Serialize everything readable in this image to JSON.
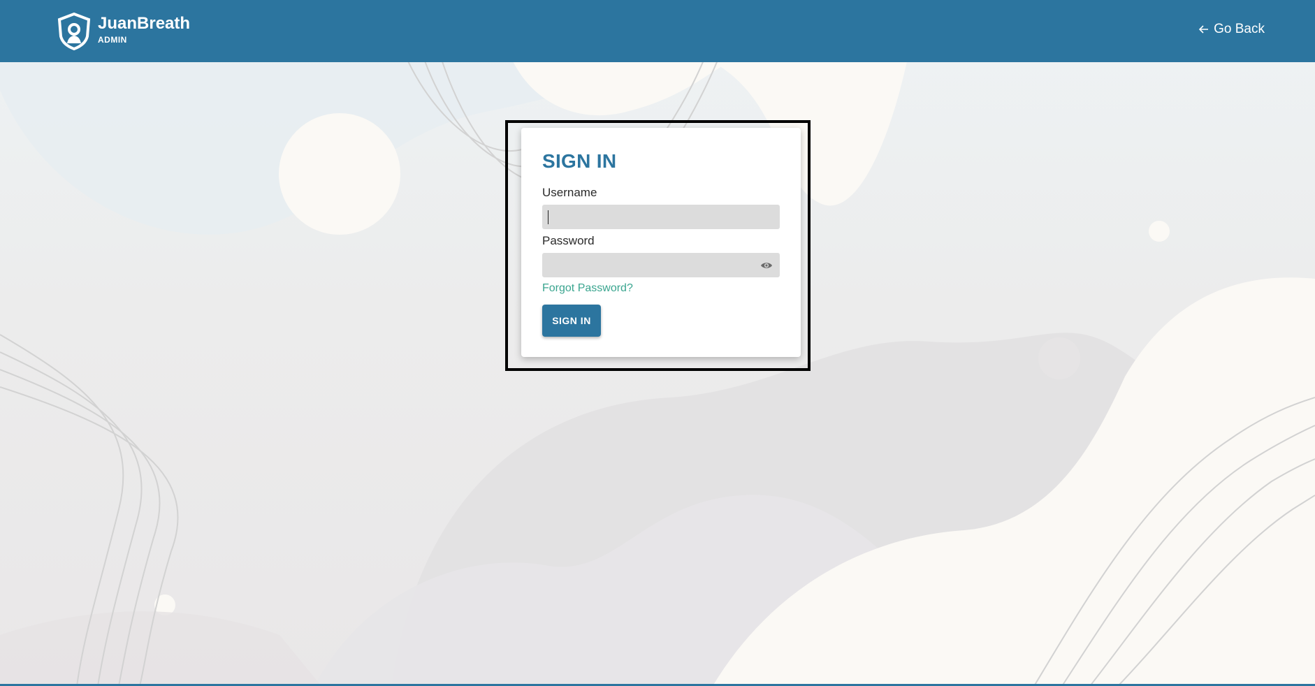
{
  "header": {
    "brand_name": "JuanBreath",
    "brand_sub": "ADMIN",
    "logo_icon": "shield-person-icon",
    "go_back_label": "Go Back",
    "go_back_icon": "arrow-left-icon",
    "background_color": "#2c759f"
  },
  "login": {
    "title": "SIGN IN",
    "username_label": "Username",
    "username_value": "",
    "password_label": "Password",
    "password_value": "",
    "password_toggle_icon": "eye-icon",
    "forgot_label": "Forgot Password?",
    "submit_label": "SIGN IN"
  },
  "colors": {
    "primary": "#2c759f",
    "link": "#3aa58f",
    "input_bg": "#dcdcdc"
  }
}
